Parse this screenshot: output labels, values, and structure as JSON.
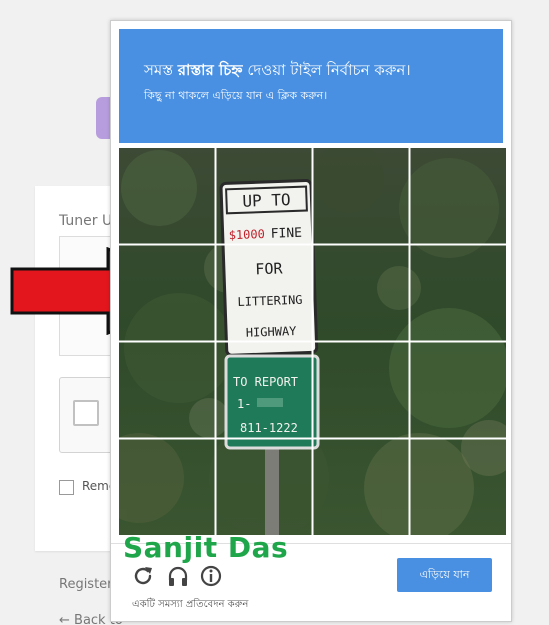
{
  "background_page": {
    "username_label": "Tuner U",
    "remember_label": "Reme",
    "register_link": "Register",
    "back_link": "← Back to"
  },
  "captcha": {
    "title_prefix": "সমস্ত ",
    "title_bold": "রাস্তার চিহ্ন",
    "title_suffix": " দেওয়া টাইল নির্বাচন করুন।",
    "subtitle": "কিছু না থাকলে এড়িয়ে যান এ ক্লিক করুন।",
    "skip_button": "এড়িয়ে যান",
    "report_link": "একটি সমস্যা প্রতিবেদন করুন",
    "reload_icon": "reload-icon",
    "audio_icon": "headphones-icon",
    "info_icon": "info-icon",
    "accent_color": "#4a90e2",
    "grid_rows": 4,
    "grid_cols": 4
  },
  "sign": {
    "top_text": "UP TO",
    "fine_amount": "$1000",
    "fine_word": "FINE",
    "line1": "FOR",
    "line2": "LITTERING",
    "line3": "HIGHWAY",
    "green_line1": "TO REPORT",
    "green_line2": "1-",
    "green_line3": "811-1222"
  },
  "watermark": "Sanjit Das",
  "arrow_color": "#e3161d"
}
